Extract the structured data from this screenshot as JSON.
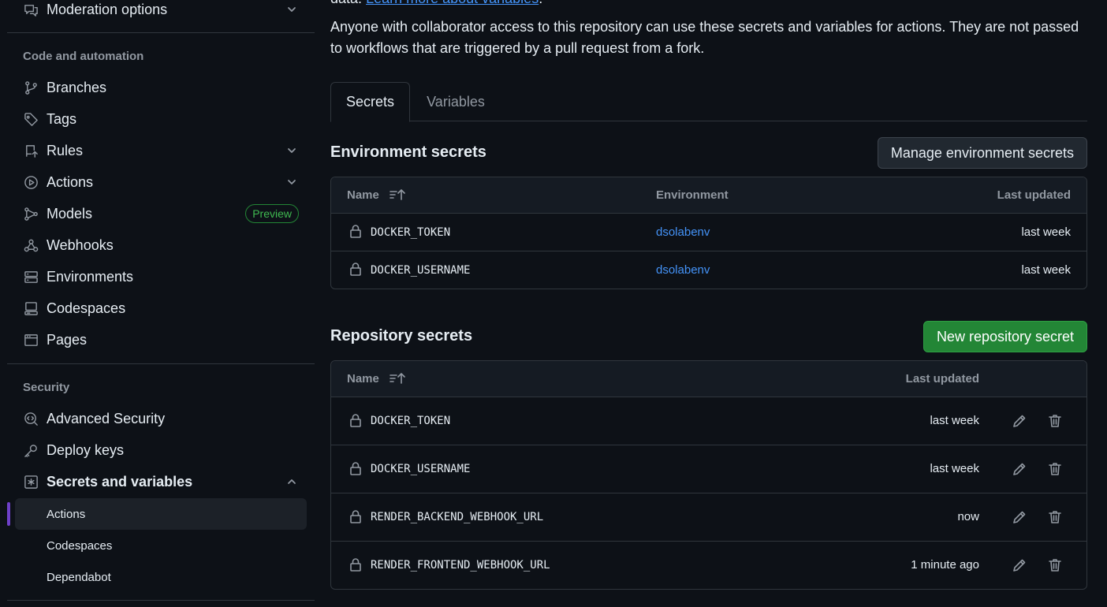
{
  "sidebar": {
    "moderation": "Moderation options",
    "code_section": "Code and automation",
    "items": {
      "branches": "Branches",
      "tags": "Tags",
      "rules": "Rules",
      "actions": "Actions",
      "models": "Models",
      "models_badge": "Preview",
      "webhooks": "Webhooks",
      "environments": "Environments",
      "codespaces": "Codespaces",
      "pages": "Pages"
    },
    "security_section": "Security",
    "security_items": {
      "advanced_security": "Advanced Security",
      "deploy_keys": "Deploy keys",
      "secrets_and_variables": "Secrets and variables"
    },
    "sub_items": {
      "actions": "Actions",
      "codespaces": "Codespaces",
      "dependabot": "Dependabot"
    }
  },
  "main": {
    "intro_top_prefix": "data.",
    "intro_top_link": "Learn more about variables",
    "intro_top_suffix": ".",
    "intro": "Anyone with collaborator access to this repository can use these secrets and variables for actions. They are not passed to workflows that are triggered by a pull request from a fork.",
    "tabs": {
      "secrets": "Secrets",
      "variables": "Variables"
    },
    "env_secrets": {
      "title": "Environment secrets",
      "manage_button": "Manage environment secrets",
      "headers": {
        "name": "Name",
        "environment": "Environment",
        "last_updated": "Last updated"
      },
      "rows": [
        {
          "name": "DOCKER_TOKEN",
          "environment": "dsolabenv",
          "updated": "last week"
        },
        {
          "name": "DOCKER_USERNAME",
          "environment": "dsolabenv",
          "updated": "last week"
        }
      ]
    },
    "repo_secrets": {
      "title": "Repository secrets",
      "new_button": "New repository secret",
      "headers": {
        "name": "Name",
        "last_updated": "Last updated"
      },
      "rows": [
        {
          "name": "DOCKER_TOKEN",
          "updated": "last week"
        },
        {
          "name": "DOCKER_USERNAME",
          "updated": "last week"
        },
        {
          "name": "RENDER_BACKEND_WEBHOOK_URL",
          "updated": "now"
        },
        {
          "name": "RENDER_FRONTEND_WEBHOOK_URL",
          "updated": "1 minute ago"
        }
      ]
    }
  },
  "colors": {
    "accent_link": "#4493f8",
    "primary_button": "#238636",
    "active_indicator": "#6e40c9",
    "preview_badge": "#3fb950"
  }
}
